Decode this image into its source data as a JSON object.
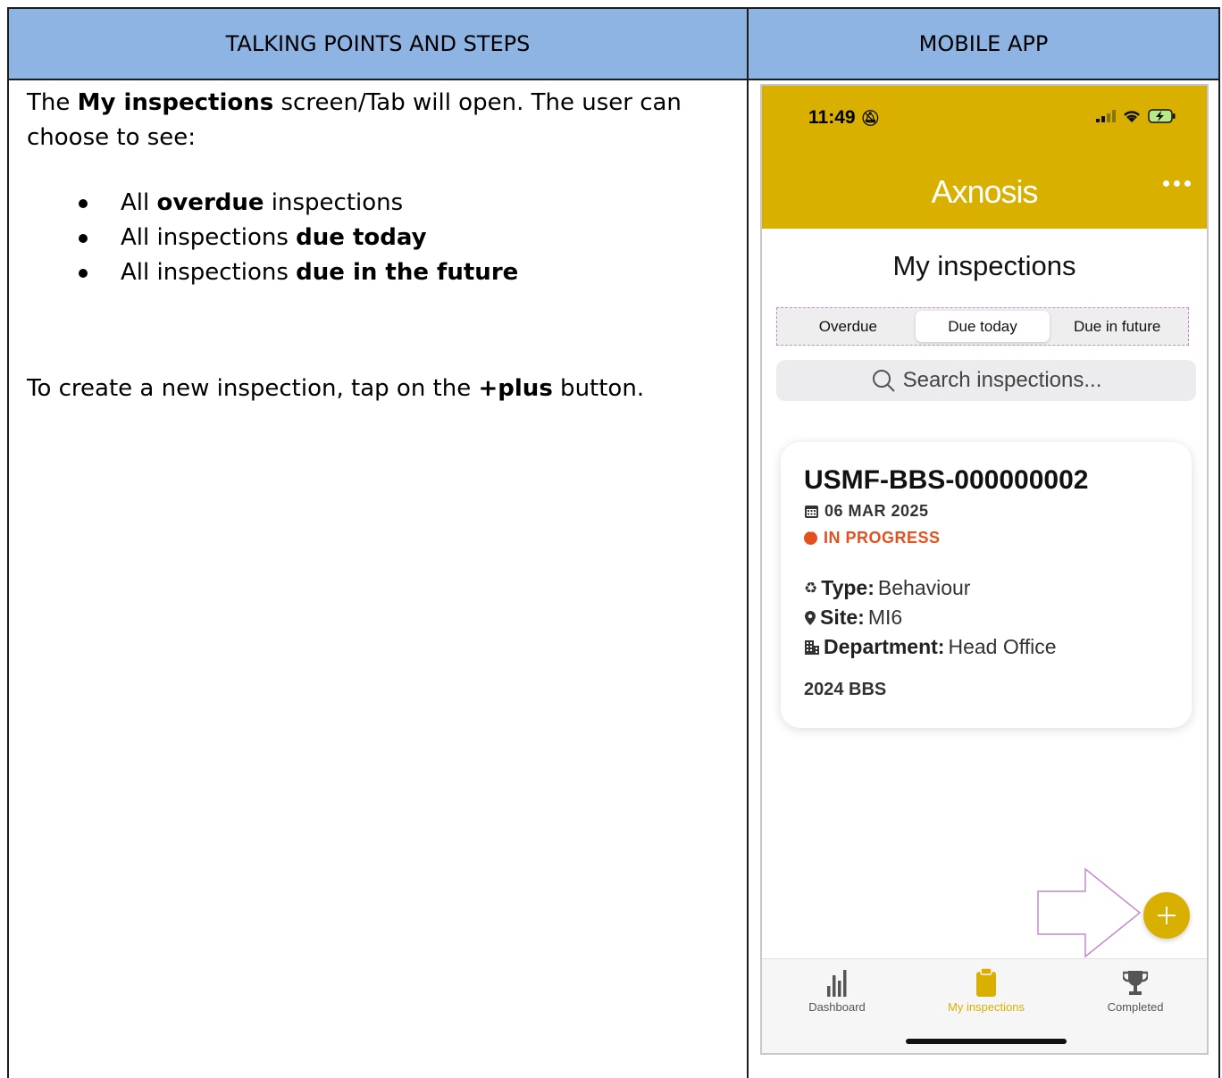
{
  "table": {
    "left_header": "TALKING POINTS AND STEPS",
    "right_header": "MOBILE APP"
  },
  "talking_points": {
    "intro_1": "The ",
    "intro_bold": "My inspections",
    "intro_2": " screen/Tab will open. The user can choose to see:",
    "bullets": [
      {
        "pre": "All ",
        "bold": "overdue",
        "post": " inspections"
      },
      {
        "pre": "All inspections ",
        "bold": "due today",
        "post": ""
      },
      {
        "pre": "All inspections ",
        "bold": "due in the future",
        "post": ""
      }
    ],
    "create_1": "To create a new inspection, tap on the ",
    "create_bold": "+plus",
    "create_2": " button."
  },
  "phone": {
    "status_time": "11:49",
    "logo_text": "Axnosis",
    "screen_title": "My inspections",
    "segments": [
      "Overdue",
      "Due today",
      "Due in future"
    ],
    "active_segment": "Due today",
    "search_placeholder": "Search inspections...",
    "card": {
      "id": "USMF-BBS-000000002",
      "date": "06 MAR 2025",
      "status": "IN PROGRESS",
      "type_label": "Type:",
      "type_value": "Behaviour",
      "site_label": "Site:",
      "site_value": "MI6",
      "department_label": "Department:",
      "department_value": "Head Office",
      "group": "2024 BBS"
    },
    "tabs": [
      "Dashboard",
      "My inspections",
      "Completed"
    ],
    "colors": {
      "brand": "#d9b000",
      "status": "#e4501e",
      "highlight": "#c58ad0"
    }
  }
}
